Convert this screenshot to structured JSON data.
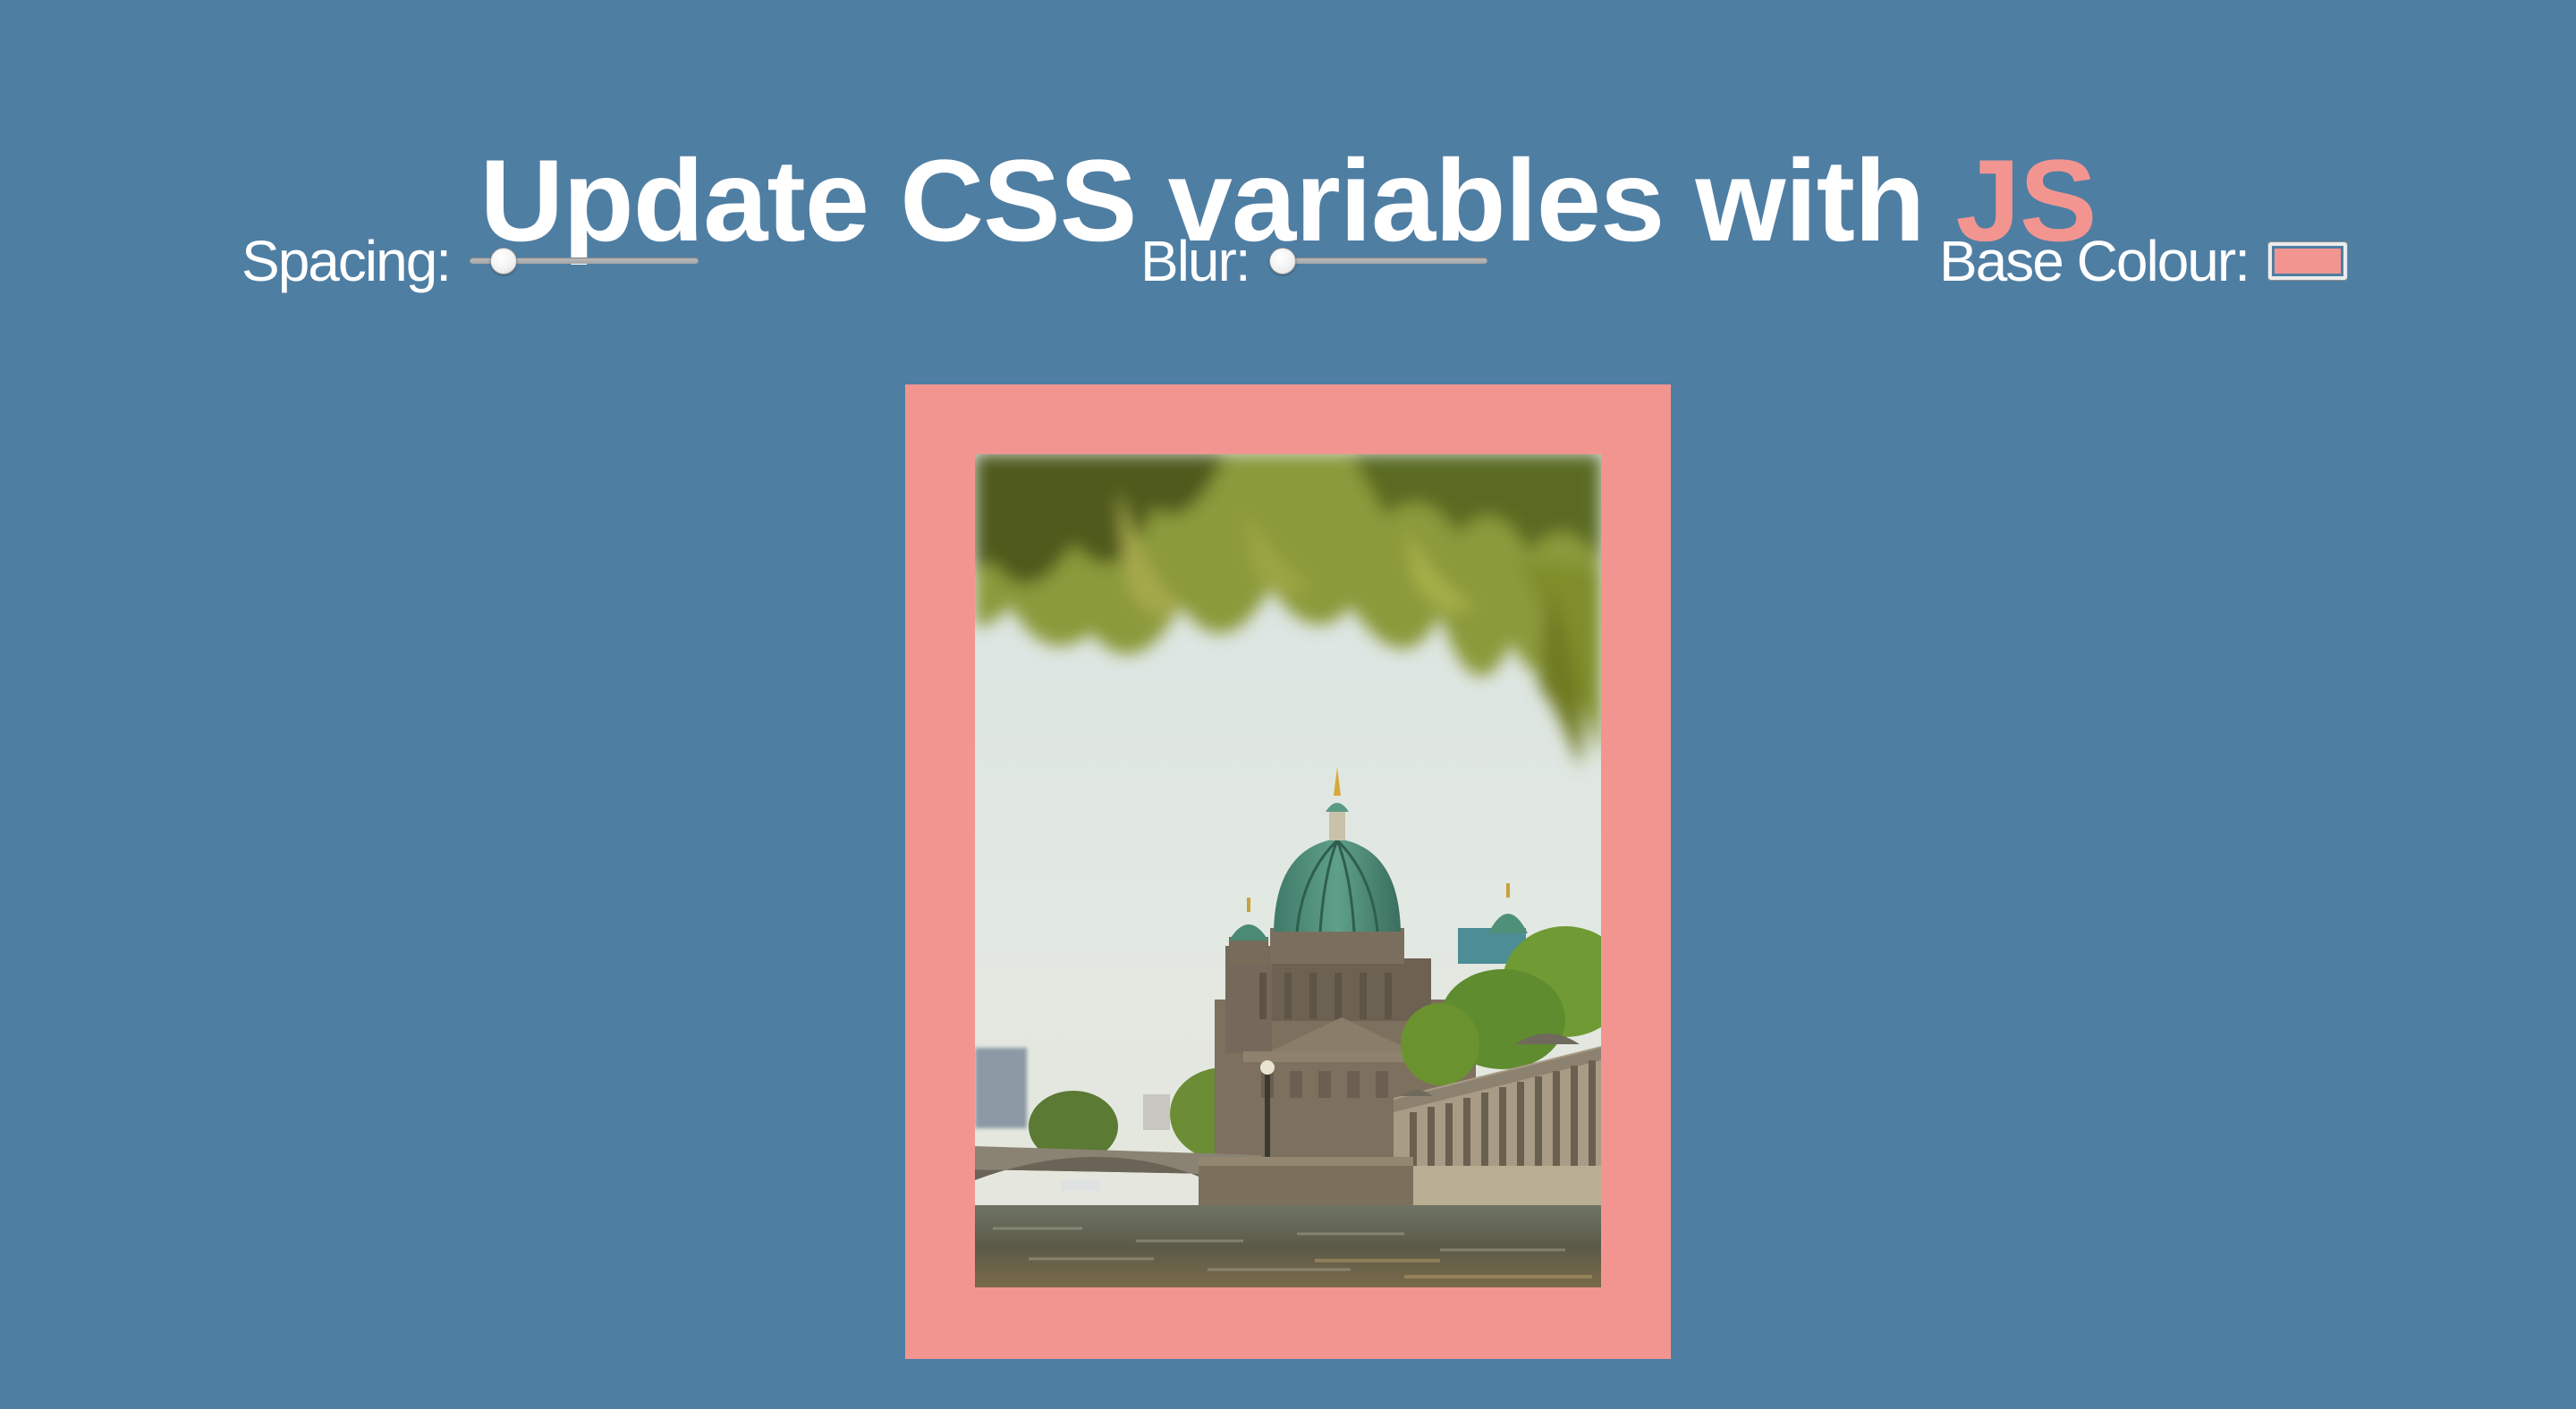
{
  "title": {
    "main": "Update CSS variables with ",
    "highlight": "JS"
  },
  "controls": {
    "spacing": {
      "label": "Spacing:",
      "value": 10,
      "min": 0,
      "max": 100
    },
    "blur": {
      "label": "Blur:",
      "value": 0,
      "min": 0,
      "max": 25
    },
    "base_colour": {
      "label": "Base Colour:",
      "value": "#f29590"
    }
  },
  "colors": {
    "background": "#4f7ea3",
    "accent": "#f29590",
    "text": "#ffffff"
  },
  "image": {
    "subject": "Berlin Cathedral dome across the river Spree framed by willow leaves"
  }
}
